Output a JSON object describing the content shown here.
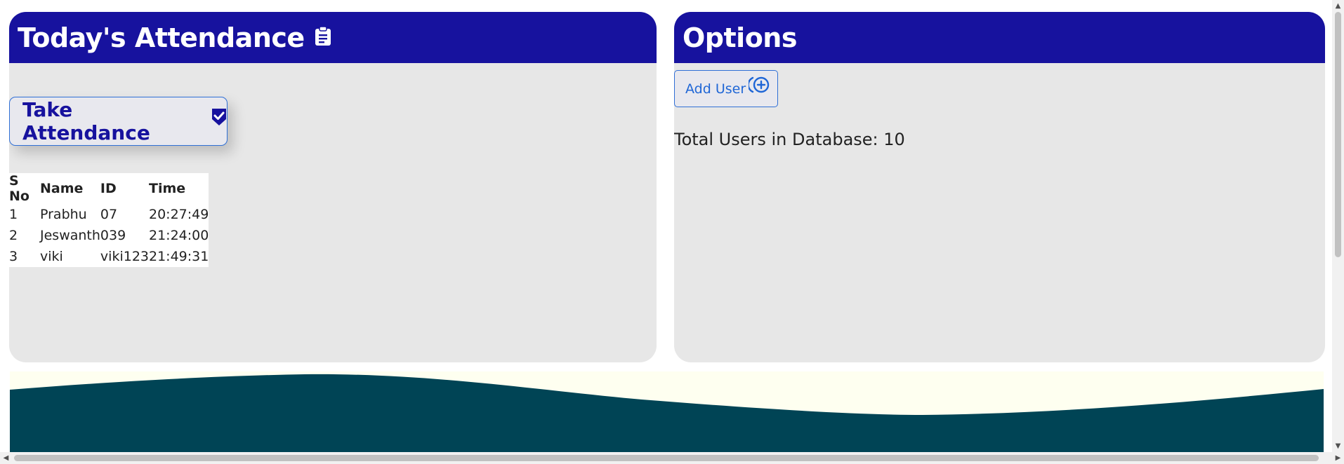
{
  "attendance_panel": {
    "title": "Today's Attendance",
    "header_icon": "clipboard-icon",
    "take_button": {
      "label": "Take Attendance",
      "icon": "shield-check-icon"
    },
    "table": {
      "headers": [
        "S No",
        "Name",
        "ID",
        "Time"
      ],
      "rows": [
        [
          "1",
          "Prabhu",
          "07",
          "20:27:49"
        ],
        [
          "2",
          "Jeswanth",
          "039",
          "21:24:00"
        ],
        [
          "3",
          "viki",
          "viki123",
          "21:49:31"
        ]
      ]
    }
  },
  "options_panel": {
    "title": "Options",
    "add_user_button": {
      "label": "Add User",
      "icon": "plus-circle-icon"
    },
    "total_users_label": "Total Users in Database: ",
    "total_users_count": "10"
  },
  "colors": {
    "header_bg": "#17129e",
    "panel_bg": "#e7e7e7",
    "accent_blue": "#1f66d6",
    "wave_dark": "#004455",
    "wave_light": "#fefff0"
  },
  "scrollbars": {
    "up_arrow": "▲",
    "down_arrow": "▼",
    "left_arrow": "◀",
    "right_arrow": "▶"
  }
}
